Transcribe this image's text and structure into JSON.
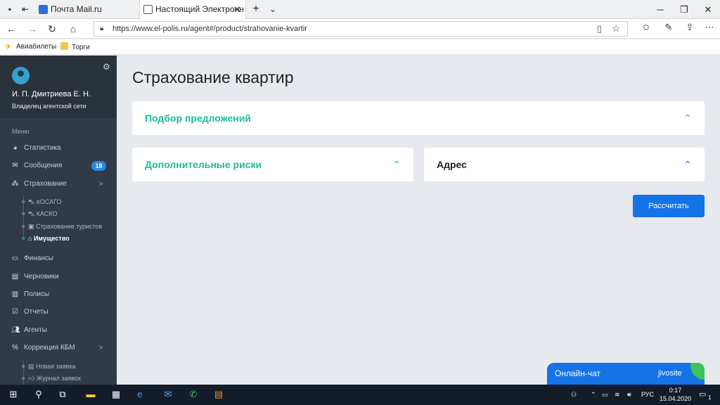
{
  "browser": {
    "tabs": [
      {
        "label": "Почта Mail.ru",
        "icon": "mail-ru-icon"
      },
      {
        "label": "Настоящий Электронн",
        "icon": "page-icon"
      }
    ],
    "url": "https://www.el-polis.ru/agent#/product/strahovanie-kvartir",
    "favorites": [
      {
        "label": "Авиабилеты",
        "icon": "plane-icon"
      },
      {
        "label": "Торги",
        "icon": "folder-icon"
      }
    ]
  },
  "sidebar": {
    "user_name": "И. П. Дмитриева Е. Н.",
    "user_role": "Владелец агентской сети",
    "menu_header": "Меню",
    "items": [
      {
        "label": "Статистика",
        "icon": "pie-chart-icon"
      },
      {
        "label": "Сообщения",
        "icon": "envelope-icon",
        "badge": "18"
      },
      {
        "label": "Страхование",
        "icon": "cubes-icon",
        "chevron": ">"
      },
      {
        "label": "Финансы",
        "icon": "money-icon"
      },
      {
        "label": "Черновики",
        "icon": "file-icon"
      },
      {
        "label": "Полисы",
        "icon": "document-icon"
      },
      {
        "label": "Отчеты",
        "icon": "checklist-icon"
      },
      {
        "label": "Агенты",
        "icon": "users-icon"
      },
      {
        "label": "Коррекция КБМ",
        "icon": "percent-icon",
        "chevron": ">"
      }
    ],
    "insurance_sub": [
      {
        "label": "еОСАГО",
        "icon": "car-icon"
      },
      {
        "label": "КАСКО",
        "icon": "car-icon"
      },
      {
        "label": "Страхование туристов",
        "icon": "luggage-icon"
      },
      {
        "label": "Имущество",
        "icon": "home-icon",
        "active": true
      }
    ],
    "kbm_sub": [
      {
        "label": "Новая заявка",
        "icon": "file-icon"
      },
      {
        "label": "Журнал заявок",
        "icon": "thumbs-up-icon"
      }
    ]
  },
  "main": {
    "title": "Страхование квартир",
    "panels": [
      {
        "label": "Подбор предложений"
      },
      {
        "label": "Дополнительные риски"
      },
      {
        "label": "Адрес"
      }
    ],
    "calculate_button": "Рассчитать"
  },
  "chat": {
    "label": "Онлайн-чат",
    "brand": "jivosite"
  },
  "taskbar": {
    "language": "РУС",
    "time": "0:17",
    "date": "15.04.2020",
    "notifications": "1"
  },
  "colors": {
    "accent": "#1bbc9b",
    "button": "#1473e6",
    "sidebar": "#313a46"
  }
}
